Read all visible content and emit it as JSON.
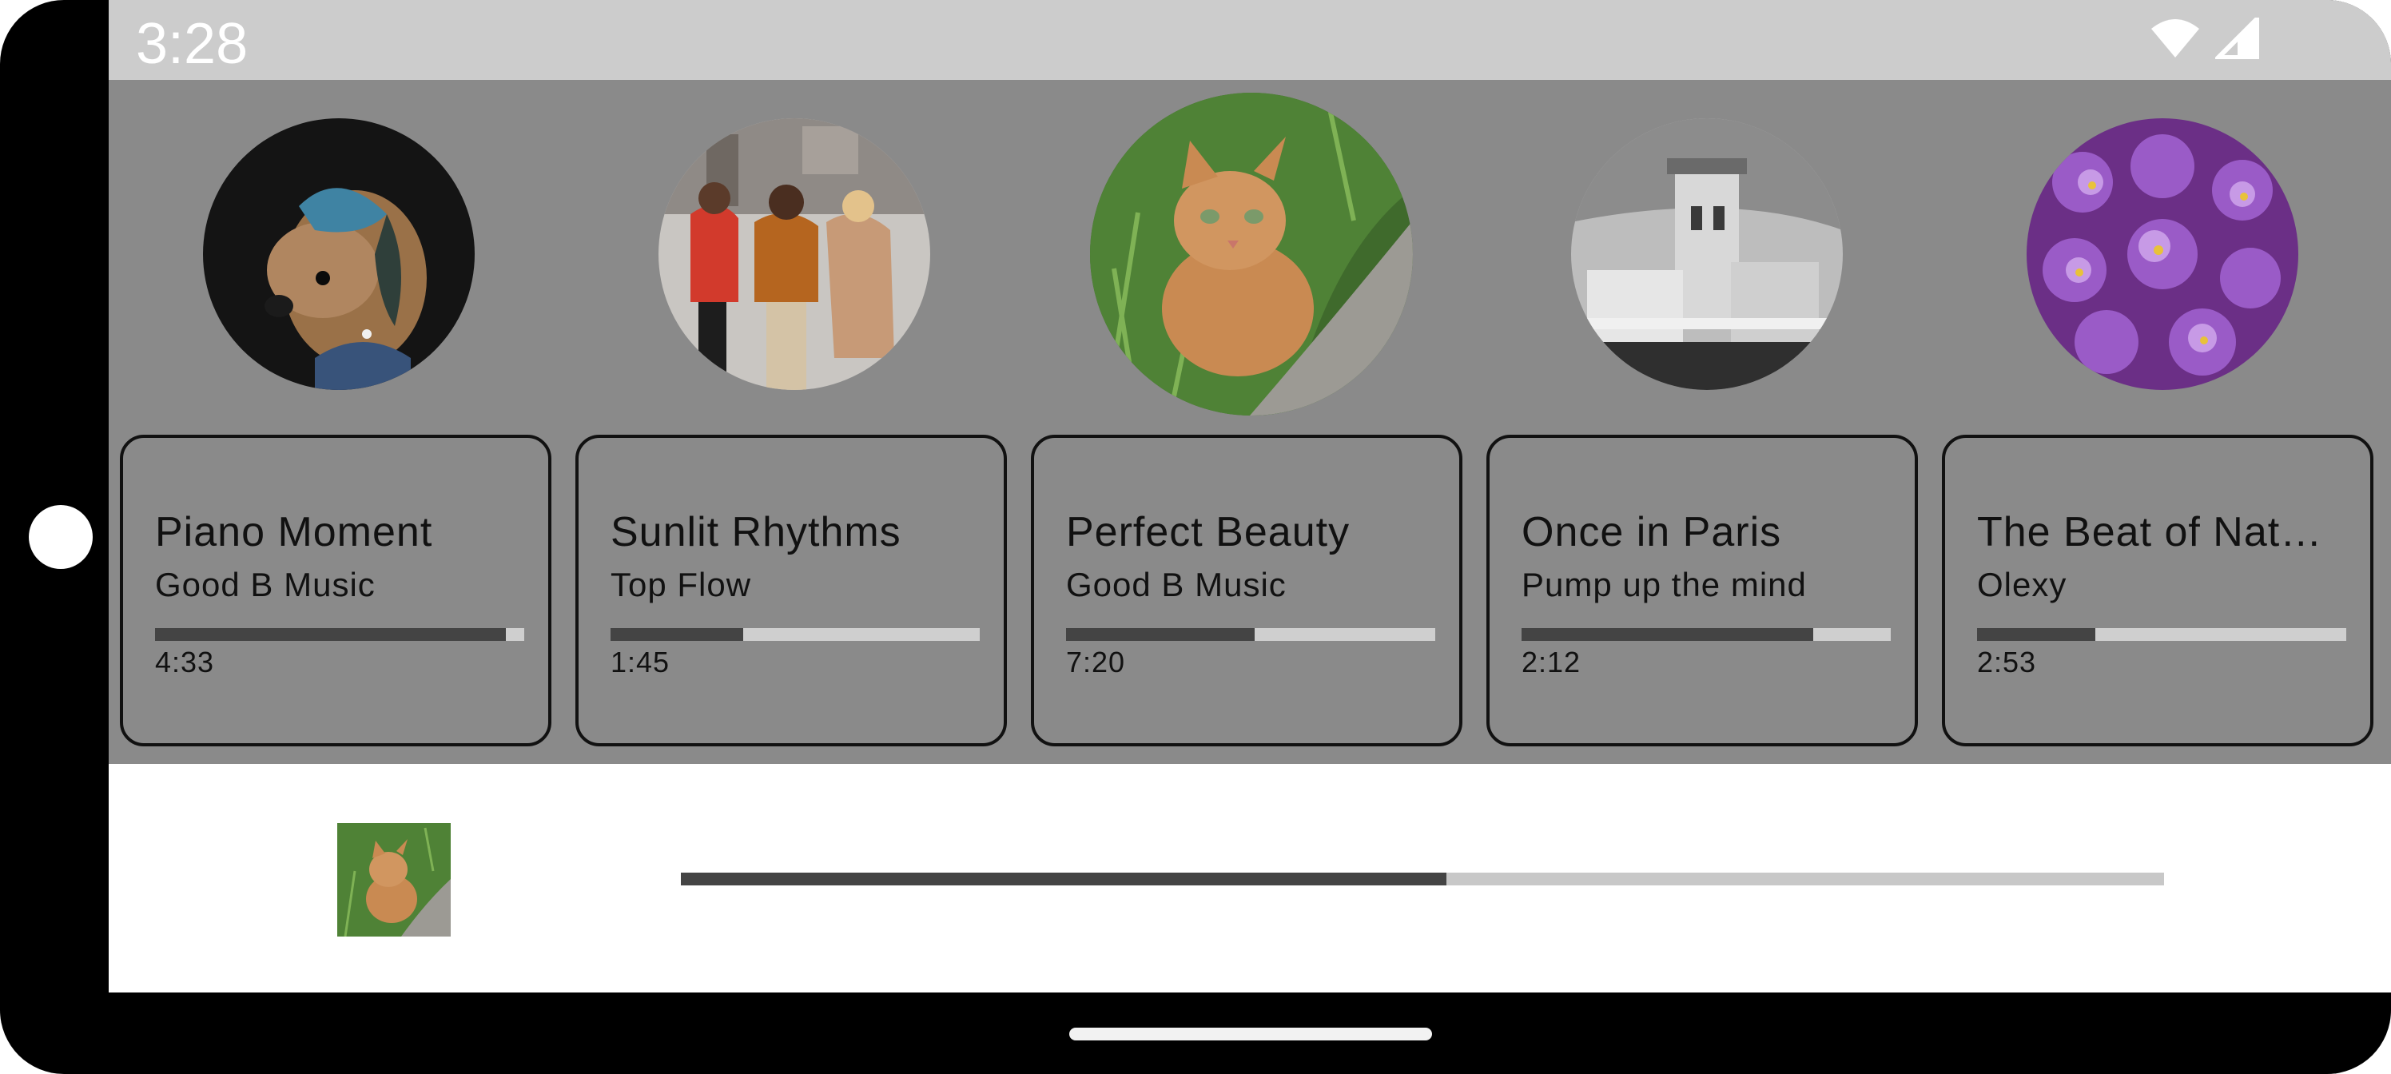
{
  "status_bar": {
    "time": "3:28",
    "icons": [
      "wifi-icon",
      "cellular-signal-icon"
    ]
  },
  "tracks": [
    {
      "title": "Piano Moment",
      "artist": "Good B Music",
      "duration": "4:33",
      "progress": 0.95,
      "artwork": "dog-portrait-artwork"
    },
    {
      "title": "Sunlit Rhythms",
      "artist": "Top Flow",
      "duration": "1:45",
      "progress": 0.36,
      "artwork": "people-walking-artwork"
    },
    {
      "title": "Perfect Beauty",
      "artist": "Good B Music",
      "duration": "7:20",
      "progress": 0.51,
      "artwork": "cat-in-grass-artwork"
    },
    {
      "title": "Once in Paris",
      "artist": "Pump up the mind",
      "duration": "2:12",
      "progress": 0.79,
      "artwork": "castle-tower-artwork"
    },
    {
      "title": "The Beat of Nat…",
      "artist": "Olexy",
      "duration": "2:53",
      "progress": 0.32,
      "artwork": "purple-flowers-artwork"
    }
  ],
  "now_playing": {
    "artwork": "cat-in-grass-artwork",
    "progress": 0.516
  },
  "colors": {
    "status_bar": "#cccccc",
    "browse_bg": "#8a8a8a",
    "progress_fill": "#444444",
    "progress_track": "#cfcfcf"
  }
}
